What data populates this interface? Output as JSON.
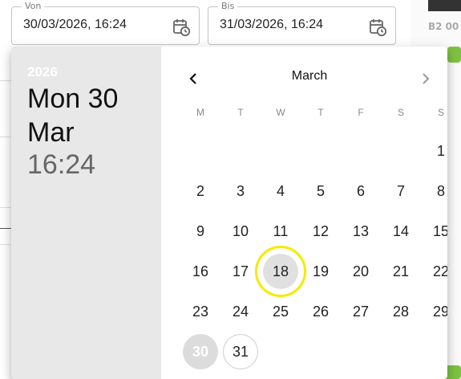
{
  "from_field": {
    "label": "Von",
    "value": "30/03/2026, 16:24",
    "icon": "calendar-clock-icon"
  },
  "to_field": {
    "label": "Bis",
    "value": "31/03/2026, 16:24",
    "icon": "calendar-clock-icon"
  },
  "background": {
    "right_label": "B2 00"
  },
  "picker": {
    "year": "2026",
    "date": "Mon 30 Mar",
    "time": "16:24",
    "month": "March",
    "prev_icon": "chevron-left-icon",
    "next_icon": "chevron-right-icon",
    "weekdays": [
      "M",
      "T",
      "W",
      "T",
      "F",
      "S",
      "S"
    ],
    "days": [
      "1",
      "2",
      "3",
      "4",
      "5",
      "6",
      "7",
      "8",
      "9",
      "10",
      "11",
      "12",
      "13",
      "14",
      "15",
      "16",
      "17",
      "18",
      "19",
      "20",
      "21",
      "22",
      "23",
      "24",
      "25",
      "26",
      "27",
      "28",
      "29",
      "30",
      "31"
    ],
    "selected_day": "30",
    "hovered_day": "18",
    "today_day": "31",
    "colors": {
      "highlight": "#f6ea00",
      "toolbar_bg": "#e8e8e8",
      "selected_bg": "#dcdcdc"
    }
  }
}
